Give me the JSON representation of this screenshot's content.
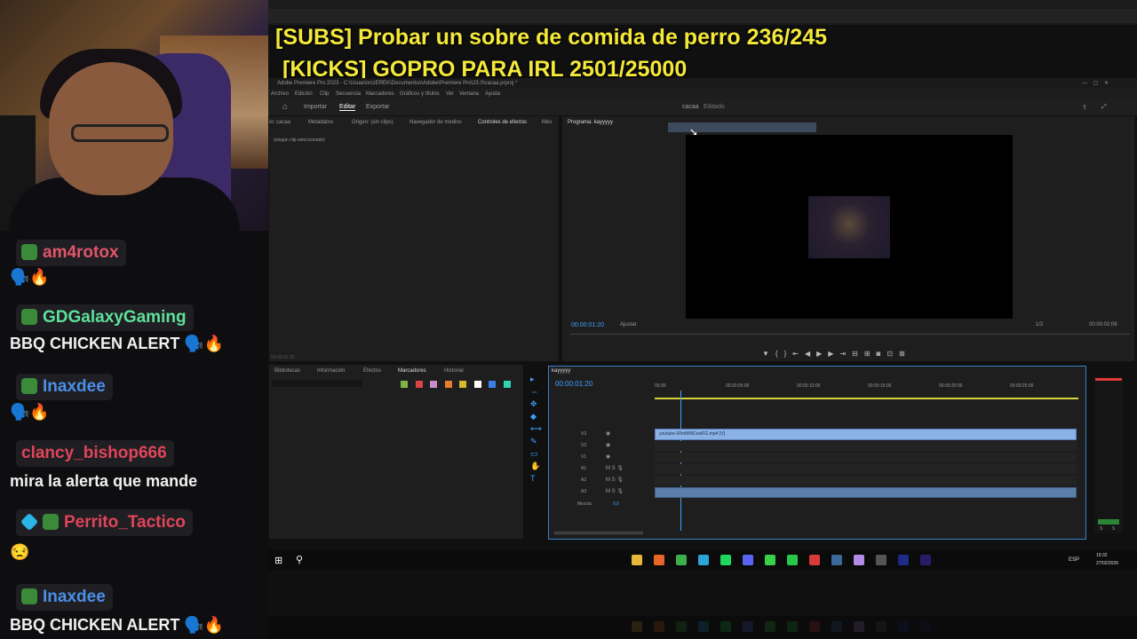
{
  "overlay": {
    "subs_goal": "[SUBS] Probar un sobre de comida de perro 236/245",
    "kicks_goal": "[KICKS] GOPRO PARA IRL 2501/25000"
  },
  "chat": {
    "messages": [
      {
        "user": "am4rotox",
        "user_color": "#e0556a",
        "text": "🗣️🔥"
      },
      {
        "user": "GDGalaxyGaming",
        "user_color": "#5ee09a",
        "text": "BBQ CHICKEN ALERT 🗣️🔥"
      },
      {
        "user": "Inaxdee",
        "user_color": "#4a8fe8",
        "text": "🗣️🔥"
      },
      {
        "user": "clancy_bishop666",
        "user_color": "#e0445a",
        "text": "mira la alerta que mande"
      },
      {
        "user": "Perrito_Tactico",
        "user_color": "#e0445a",
        "text": "😒"
      },
      {
        "user": "Inaxdee",
        "user_color": "#4a8fe8",
        "text": "BBQ CHICKEN ALERT 🗣️🔥"
      }
    ]
  },
  "premiere": {
    "window_title": "Adobe Premiere Pro 2023 - C:\\Usuarios\\zEREK\\Documentos\\Adobe\\Premiere Pro\\23.0\\cacaa.prproj *",
    "menu": [
      "Archivo",
      "Edición",
      "Clip",
      "Secuencia",
      "Marcadores",
      "Gráficos y títulos",
      "Ver",
      "Ventana",
      "Ayuda"
    ],
    "workspace_tabs": [
      "Importar",
      "Editar",
      "Exportar"
    ],
    "active_workspace": "Editar",
    "project_name": "cacaa",
    "project_state": "Editado",
    "source_tabs": [
      "io: cacaa",
      "Metadatos",
      "Origen: (sin clips)",
      "Navegador de medios",
      "Controles de efectos",
      "Mes"
    ],
    "no_clip_selected": "(ningún clip seleccionado)",
    "program_label": "Programa: kayyyyy",
    "program_timecode": "00:00:01:20",
    "fit_label": "Ajustar",
    "resolution": "1/2",
    "duration": "00:00:02:06",
    "effects_timecode": "00:00:01:20",
    "project_tabs": [
      "Bibliotecas",
      "Información",
      "Efectos",
      "Marcadores",
      "Historial"
    ],
    "marker_colors": [
      "#7fb347",
      "#d9434a",
      "#c78fc7",
      "#e87d2f",
      "#d6b830",
      "#ffffff",
      "#3d7fe6",
      "#2fd6b5"
    ],
    "sequence_name": "kayyyyy",
    "timeline_timecode": "00:00:01:20",
    "ruler": [
      "00:00",
      "00:00:05:00",
      "00:00:10:00",
      "00:00:15:00",
      "00:00:20:00",
      "00:00:25:00"
    ],
    "tracks_video": [
      "V3",
      "V2",
      "V1"
    ],
    "tracks_audio": [
      "A1",
      "A2",
      "A3"
    ],
    "mix_label": "Mezcla",
    "mix_value": "0,0",
    "video_clip_label": "youtube-00mMiNCoelFG.mp4 [V]",
    "meter_labels": [
      "S",
      "S"
    ]
  },
  "taskbar": {
    "time": "19:32",
    "date": "27/02/2026",
    "lang": "ESP",
    "apps": [
      {
        "name": "folder-icon",
        "color": "#e8b73a"
      },
      {
        "name": "firefox-icon",
        "color": "#e8652a"
      },
      {
        "name": "chrome-icon",
        "color": "#3cae4a"
      },
      {
        "name": "edge-icon",
        "color": "#2aa4d8"
      },
      {
        "name": "spotify-icon",
        "color": "#1ed760"
      },
      {
        "name": "discord-icon",
        "color": "#5865f2"
      },
      {
        "name": "play-icon",
        "color": "#38d048"
      },
      {
        "name": "green-app-icon",
        "color": "#28c84a"
      },
      {
        "name": "red-app-icon",
        "color": "#d83a3a"
      },
      {
        "name": "steam-icon",
        "color": "#3a6a9a"
      },
      {
        "name": "globe-icon",
        "color": "#b48ae8"
      },
      {
        "name": "terminal-icon",
        "color": "#555555"
      },
      {
        "name": "n-app-icon",
        "color": "#1d2a8a"
      },
      {
        "name": "premiere-icon",
        "color": "#2a1a6a"
      }
    ]
  }
}
